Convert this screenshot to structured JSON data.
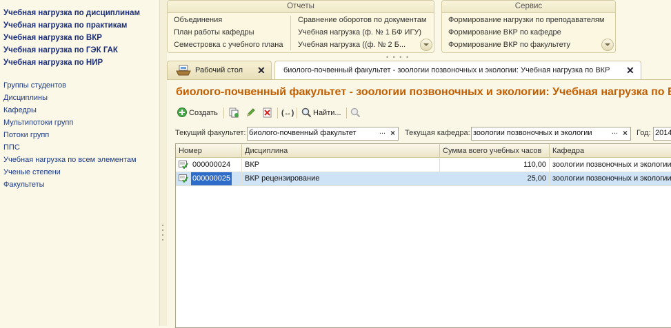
{
  "left_panel": {
    "main_links": [
      "Учебная нагрузка по дисциплинам",
      "Учебная нагрузка по практикам",
      "Учебная нагрузка по ВКР",
      "Учебная нагрузка по ГЭК ГАК",
      "Учебная нагрузка по НИР"
    ],
    "links": [
      "Группы студентов",
      "Дисциплины",
      "Кафедры",
      "Мультипотоки групп",
      "Потоки групп",
      "ППС",
      "Учебная нагрузка по всем элементам",
      "Ученые степени",
      "Факультеты"
    ]
  },
  "reports_panel": {
    "title": "Отчеты",
    "col1": [
      "Объединения",
      "План работы кафедры",
      "Семестровка с учебного плана"
    ],
    "col2": [
      "Сравнение оборотов по документам",
      "Учебная нагрузка (ф. № 1 БФ ИГУ)",
      "Учебная нагрузка ((ф. № 2 Б..."
    ]
  },
  "service_panel": {
    "title": "Сервис",
    "items": [
      "Формирование нагрузки по преподавателям",
      "Формирование ВКР по кафедре",
      "Формирование ВКР по факультету"
    ]
  },
  "tabs": [
    {
      "label": "Рабочий стол",
      "icon": "desktop-icon"
    },
    {
      "label": "биолого-почвенный факультет - зоологии позвоночных и экологии: Учебная нагрузка по ВКР",
      "icon": ""
    }
  ],
  "page": {
    "title": "биолого-почвенный факультет - зоологии позвоночных и экологии: Учебная нагрузка по ВКР"
  },
  "toolbar": {
    "create_label": "Создать",
    "find_label": "Найти..."
  },
  "filters": {
    "faculty_label": "Текущий факультет:",
    "faculty_value": "биолого-почвенный факультет",
    "department_label": "Текущая кафедра:",
    "department_value": "зоологии позвоночных и экологии",
    "year_label": "Год:",
    "year_value": "2014"
  },
  "table": {
    "columns": [
      "Номер",
      "Дисциплина",
      "Сумма всего учебных часов",
      "Кафедра"
    ],
    "rows": [
      {
        "number": "000000024",
        "discipline": "ВКР",
        "hours": "110,00",
        "department": "зоологии позвоночных и экологии",
        "selected": false
      },
      {
        "number": "000000025",
        "discipline": "ВКР рецензирование",
        "hours": "25,00",
        "department": "зоологии позвоночных и экологии",
        "selected": true
      }
    ]
  },
  "colors": {
    "title_orange": "#c25e00",
    "link_blue": "#1a2d7a",
    "selection": "#cfe3f6",
    "background": "#fbf8e8"
  }
}
